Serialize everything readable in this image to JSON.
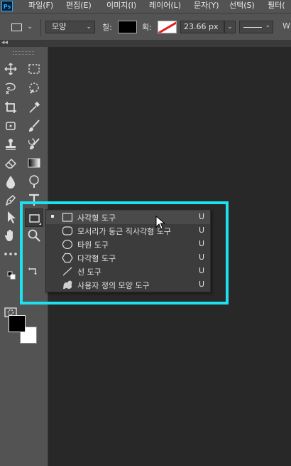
{
  "menubar": {
    "app_logo": "Ps",
    "items": [
      "파일(F)",
      "편집(E)",
      "이미지(I)",
      "레이어(L)",
      "문자(Y)",
      "선택(S)",
      "필터("
    ]
  },
  "options_bar": {
    "tool_icon": "rectangle-shape-icon",
    "mode_select": "모양",
    "fill_label": "칠:",
    "fill_color": "#000000",
    "stroke_label": "획:",
    "stroke_color": "none",
    "stroke_width": "23.66 px",
    "overflow_label": "W"
  },
  "toolbar": {
    "active_tool": "rectangle-tool",
    "foreground_color": "#000000",
    "background_color": "#ffffff",
    "tools": [
      "move-tool",
      "rectangular-marquee-tool",
      "lasso-tool",
      "quick-selection-tool",
      "crop-tool",
      "eyedropper-tool",
      "spot-healing-brush-tool",
      "brush-tool",
      "clone-stamp-tool",
      "history-brush-tool",
      "eraser-tool",
      "gradient-tool",
      "blur-tool",
      "dodge-tool",
      "pen-tool",
      "type-tool",
      "path-selection-tool",
      "rectangle-tool",
      "hand-tool",
      "zoom-tool",
      "edit-toolbar",
      "swap-colors",
      "default-colors",
      "quick-mask-mode"
    ]
  },
  "flyout": {
    "items": [
      {
        "label": "사각형 도구",
        "shortcut": "U",
        "icon": "rectangle-icon",
        "selected": true
      },
      {
        "label": "모서리가 둥근 직사각형 도구",
        "shortcut": "U",
        "icon": "rounded-rectangle-icon",
        "selected": false
      },
      {
        "label": "타원 도구",
        "shortcut": "U",
        "icon": "ellipse-icon",
        "selected": false
      },
      {
        "label": "다각형 도구",
        "shortcut": "U",
        "icon": "polygon-icon",
        "selected": false
      },
      {
        "label": "선 도구",
        "shortcut": "U",
        "icon": "line-icon",
        "selected": false
      },
      {
        "label": "사용자 정의 모양 도구",
        "shortcut": "U",
        "icon": "custom-shape-icon",
        "selected": false
      }
    ]
  },
  "colors": {
    "highlight": "#1ee0f0",
    "panel": "#535353",
    "canvas": "#282828"
  }
}
